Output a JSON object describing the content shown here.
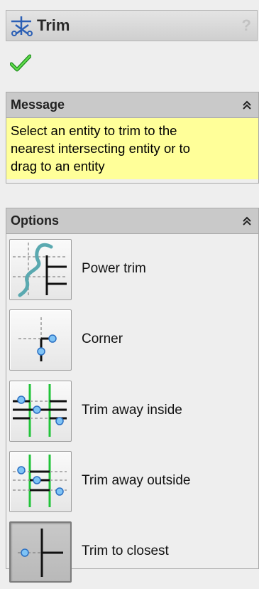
{
  "window": {
    "title": "Trim",
    "help_glyph": "?",
    "title_icon": "trim-scissors-icon",
    "ok_icon": "green-checkmark-icon"
  },
  "message": {
    "header": "Message",
    "lines": [
      "Select an entity to trim to the",
      "nearest intersecting entity or to",
      "drag to an entity"
    ],
    "background_color": "#ffff99"
  },
  "options": {
    "header": "Options",
    "selected": "Trim to closest",
    "items": [
      {
        "label": "Power trim",
        "icon": "power-trim-icon"
      },
      {
        "label": "Corner",
        "icon": "corner-icon"
      },
      {
        "label": "Trim away inside",
        "icon": "trim-away-inside-icon"
      },
      {
        "label": "Trim away outside",
        "icon": "trim-away-outside-icon"
      },
      {
        "label": "Trim to closest",
        "icon": "trim-to-closest-icon"
      }
    ]
  },
  "colors": {
    "accent_blue": "#4a9be8",
    "accent_green": "#22c43a",
    "curve_teal": "#5aa9b0"
  }
}
